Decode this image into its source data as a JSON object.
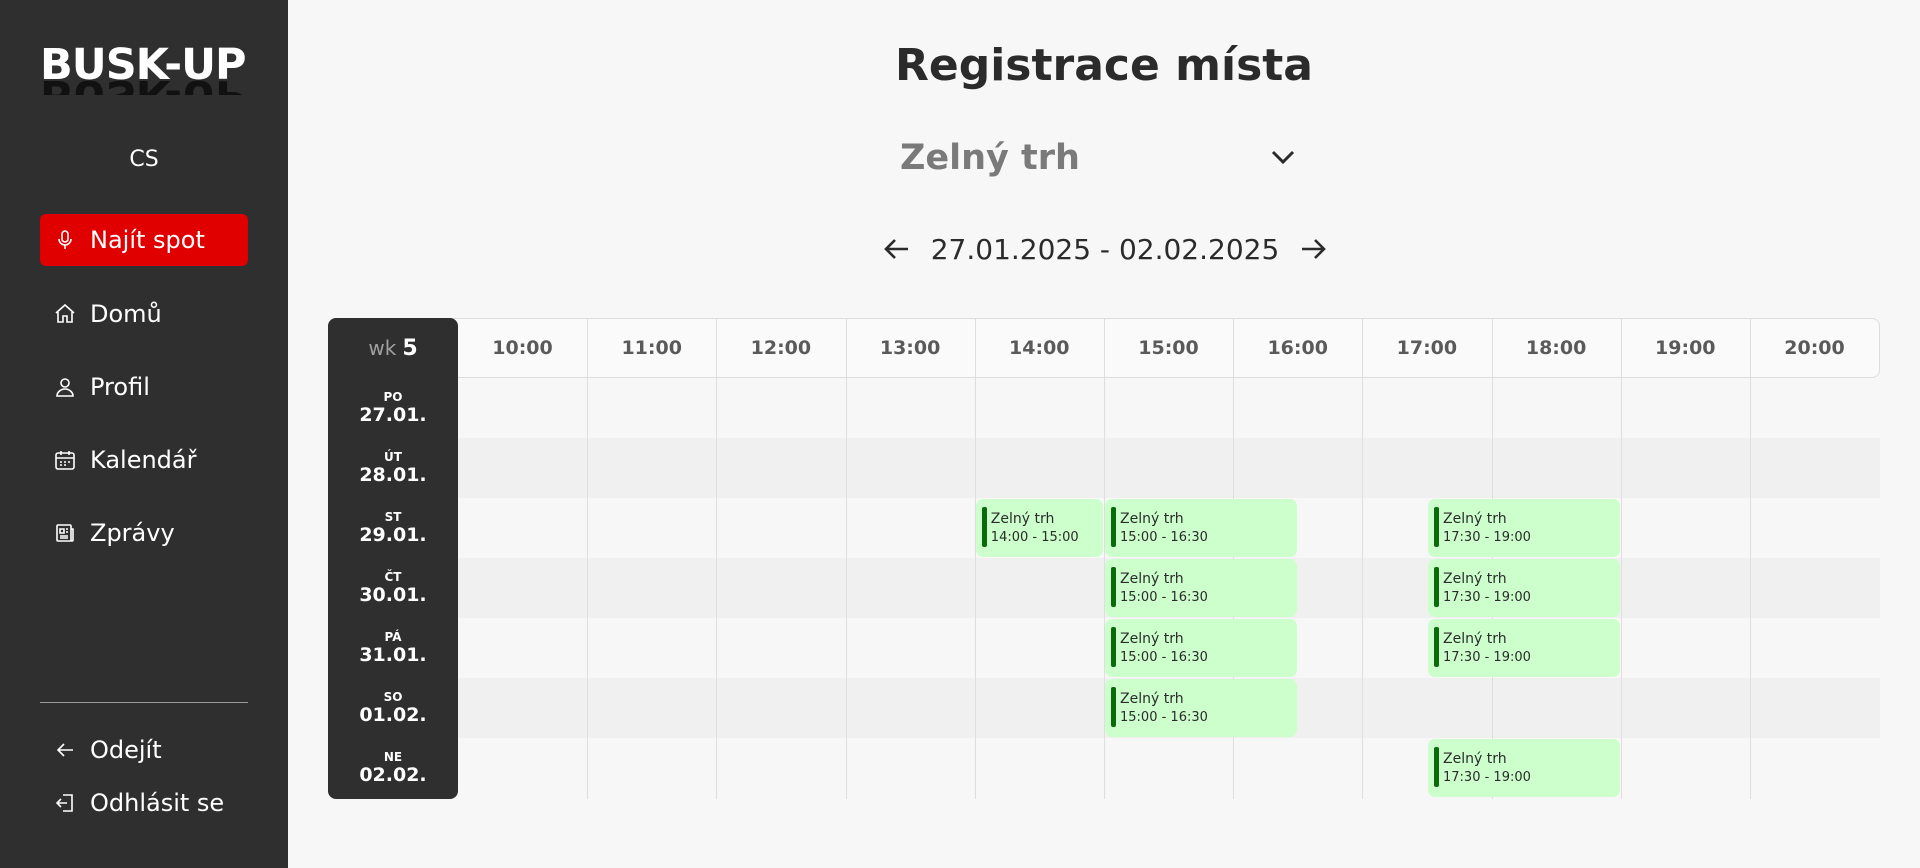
{
  "app": {
    "logo": "BUSK-UP",
    "language": "CS"
  },
  "sidebar": {
    "items": [
      {
        "label": "Najít spot",
        "icon": "microphone-icon",
        "active": true
      },
      {
        "label": "Domů",
        "icon": "home-icon"
      },
      {
        "label": "Profil",
        "icon": "user-icon"
      },
      {
        "label": "Kalendář",
        "icon": "calendar-icon"
      },
      {
        "label": "Zprávy",
        "icon": "news-icon"
      }
    ],
    "bottom": [
      {
        "label": "Odejít",
        "icon": "arrow-left-icon"
      },
      {
        "label": "Odhlásit se",
        "icon": "logout-icon"
      }
    ]
  },
  "main": {
    "title": "Registrace místa",
    "location_select": "Zelný trh",
    "week_range": "27.01.2025 - 02.02.2025"
  },
  "calendar": {
    "week_prefix": "wk",
    "week_number": "5",
    "hours": [
      "10:00",
      "11:00",
      "12:00",
      "13:00",
      "14:00",
      "15:00",
      "16:00",
      "17:00",
      "18:00",
      "19:00",
      "20:00"
    ],
    "days": [
      {
        "name": "PO",
        "date": "27.01."
      },
      {
        "name": "ÚT",
        "date": "28.01."
      },
      {
        "name": "ST",
        "date": "29.01."
      },
      {
        "name": "ČT",
        "date": "30.01."
      },
      {
        "name": "PÁ",
        "date": "31.01."
      },
      {
        "name": "SO",
        "date": "01.02."
      },
      {
        "name": "NE",
        "date": "02.02."
      }
    ],
    "slots": [
      {
        "day": 2,
        "start": "14:00",
        "end": "15:00",
        "name": "Zelný trh",
        "time": "14:00 - 15:00"
      },
      {
        "day": 2,
        "start": "15:00",
        "end": "16:30",
        "name": "Zelný trh",
        "time": "15:00 - 16:30"
      },
      {
        "day": 2,
        "start": "17:30",
        "end": "19:00",
        "name": "Zelný trh",
        "time": "17:30 - 19:00"
      },
      {
        "day": 3,
        "start": "15:00",
        "end": "16:30",
        "name": "Zelný trh",
        "time": "15:00 - 16:30"
      },
      {
        "day": 3,
        "start": "17:30",
        "end": "19:00",
        "name": "Zelný trh",
        "time": "17:30 - 19:00"
      },
      {
        "day": 4,
        "start": "15:00",
        "end": "16:30",
        "name": "Zelný trh",
        "time": "15:00 - 16:30"
      },
      {
        "day": 4,
        "start": "17:30",
        "end": "19:00",
        "name": "Zelný trh",
        "time": "17:30 - 19:00"
      },
      {
        "day": 5,
        "start": "15:00",
        "end": "16:30",
        "name": "Zelný trh",
        "time": "15:00 - 16:30"
      },
      {
        "day": 6,
        "start": "17:30",
        "end": "19:00",
        "name": "Zelný trh",
        "time": "17:30 - 19:00"
      }
    ]
  },
  "colors": {
    "sidebar_bg": "#2f2f2f",
    "accent_red": "#e00000",
    "slot_bg": "#ccffcc",
    "slot_bar": "#0b6a0b"
  }
}
